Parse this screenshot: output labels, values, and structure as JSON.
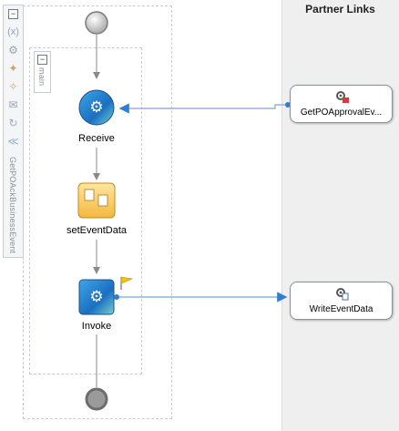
{
  "partner_panel": {
    "title": "Partner Links"
  },
  "process": {
    "name": "GetPOAckBusinessEvent",
    "scope_label": "main"
  },
  "activities": [
    {
      "label": "Receive"
    },
    {
      "label": "setEventData"
    },
    {
      "label": "Invoke"
    }
  ],
  "partner_links": [
    {
      "name": "GetPOApprovalEv..."
    },
    {
      "name": "WriteEventData"
    }
  ],
  "toolbar_icons": [
    "collapse-icon",
    "variables-icon",
    "gear-icon",
    "correlation-icon",
    "partner-link-icon",
    "message-icon",
    "refresh-icon",
    "alarm-icon"
  ]
}
